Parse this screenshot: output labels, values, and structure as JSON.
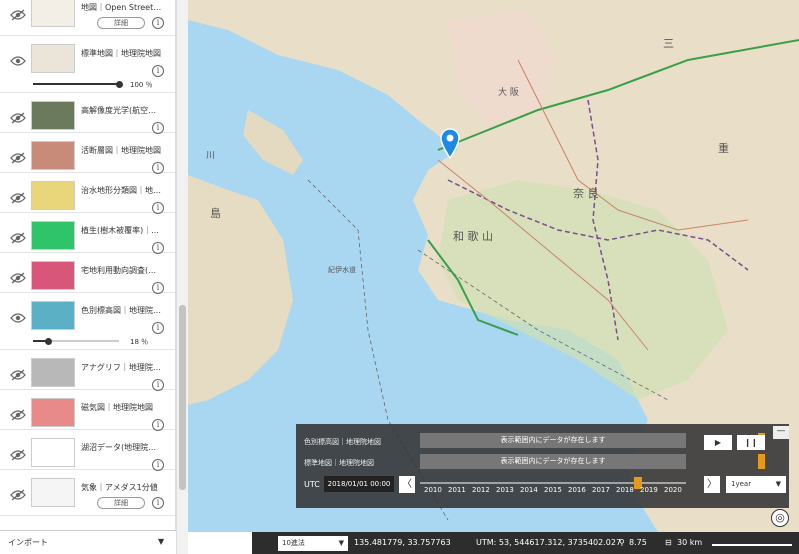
{
  "sidebar": {
    "layers": [
      {
        "name": "地図｜Open Street ...",
        "detail": "詳細",
        "info": "i",
        "hidden": true
      },
      {
        "name": "標準地図｜地理院地図",
        "opacity": "100 ％",
        "opacity_value": 1.0,
        "info": "i",
        "hidden": false
      },
      {
        "name": "高解像度光学(航空写...",
        "info": "i",
        "hidden": true
      },
      {
        "name": "活断層図｜地理院地図",
        "info": "i",
        "hidden": true
      },
      {
        "name": "治水地形分類図｜地理...",
        "info": "i",
        "hidden": true
      },
      {
        "name": "植生(樹木被覆率)｜...",
        "info": "i",
        "hidden": true
      },
      {
        "name": "宅地利用動向調査(首...",
        "info": "i",
        "hidden": true
      },
      {
        "name": "色別標高図｜地理院地...",
        "opacity": "18 ％",
        "opacity_value": 0.18,
        "info": "i",
        "hidden": false
      },
      {
        "name": "アナグリフ｜地理院地図",
        "info": "i",
        "hidden": true
      },
      {
        "name": "磁気図｜地理院地図",
        "info": "i",
        "hidden": true
      },
      {
        "name": "湖沼データ(地理院地図)",
        "info": "i",
        "hidden": true
      },
      {
        "name": "気象｜アメダス1分値",
        "detail": "詳細",
        "info": "i",
        "hidden": true
      }
    ],
    "import_label": "インポート",
    "import_arrow": "▼"
  },
  "map": {
    "labels": [
      "大 阪",
      "奈 良",
      "和 歌 山",
      "三",
      "重",
      "島",
      "川",
      "紀伊水道"
    ]
  },
  "time_panel": {
    "minimize": "—",
    "rows": [
      {
        "label": "色別標高図｜地理院地図",
        "message": "表示範囲内にデータが存在します"
      },
      {
        "label": "標準地図｜地理院地図",
        "message": "表示範囲内にデータが存在します"
      }
    ],
    "play": "▶",
    "pause": "❙❙",
    "utc_label": "UTC",
    "datetime": "2018/01/01 00:00",
    "prev": "〈",
    "next": "〉",
    "years": [
      "2010",
      "2011",
      "2012",
      "2013",
      "2014",
      "2015",
      "2016",
      "2017",
      "2018",
      "2019",
      "2020"
    ],
    "period": "1year",
    "period_arrow": "▼"
  },
  "statusbar": {
    "coord_system": "10進法",
    "coord_arrow": "▼",
    "lonlat": "135.481779, 33.757763",
    "utm": "UTM: 53, 544617.312, 3735402.027",
    "zoom": "8.75",
    "scale": "30 km"
  },
  "colors": {
    "accent_orange": "#e39a1e",
    "pin_blue": "#1e88e5",
    "panel_bg": "#333333"
  }
}
